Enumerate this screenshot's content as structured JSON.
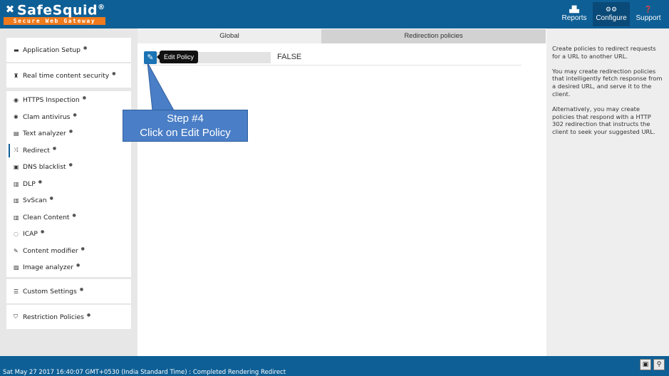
{
  "header": {
    "logo": {
      "name": "SafeSquid",
      "registered": "®",
      "tagline": "Secure Web Gateway"
    },
    "nav": [
      {
        "label": "Reports",
        "icon": "chart-icon"
      },
      {
        "label": "Configure",
        "icon": "cogs-icon",
        "active": true
      },
      {
        "label": "Support",
        "icon": "question-icon"
      }
    ]
  },
  "sidebar": {
    "application_setup": "Application Setup",
    "realtime_security": "Real time content security",
    "modules": [
      {
        "label": "HTTPS Inspection",
        "icon": "eye-icon"
      },
      {
        "label": "Clam antivirus",
        "icon": "bug-icon"
      },
      {
        "label": "Text analyzer",
        "icon": "file-text-icon"
      },
      {
        "label": "Redirect",
        "icon": "random-icon",
        "active": true
      },
      {
        "label": "DNS blacklist",
        "icon": "dns-icon"
      },
      {
        "label": "DLP",
        "icon": "barcode-icon"
      },
      {
        "label": "SvScan",
        "icon": "barcode-icon"
      },
      {
        "label": "Clean Content",
        "icon": "barcode-icon"
      },
      {
        "label": "ICAP",
        "icon": "circle-icon"
      },
      {
        "label": "Content modifier",
        "icon": "edit-icon"
      },
      {
        "label": "Image analyzer",
        "icon": "image-icon"
      }
    ],
    "custom_settings": "Custom Settings",
    "restriction_policies": "Restriction Policies"
  },
  "tabs": {
    "global": "Global",
    "redirection": "Redirection policies"
  },
  "policy_row": {
    "tooltip": "Edit Policy",
    "value": "FALSE"
  },
  "callout": {
    "line1": "Step #4",
    "line2": "Click on Edit Policy"
  },
  "help": {
    "p1": "Create policies to redirect requests for a URL to another URL.",
    "p2": "You may create redirection policies that intelligently fetch response from a desired URL, and serve it to the client.",
    "p3": "Alternatively, you may create policies that respond with a HTTP 302 redirection that instructs the client to seek your suggested URL."
  },
  "footer": {
    "status": "Sat May 27 2017 16:40:07 GMT+0530 (India Standard Time) : Completed Rendering Redirect"
  },
  "colors": {
    "header": "#0e5f96",
    "accent": "#1a73b5",
    "callout": "#4a7ec6",
    "logo_tag": "#f07a1c"
  }
}
